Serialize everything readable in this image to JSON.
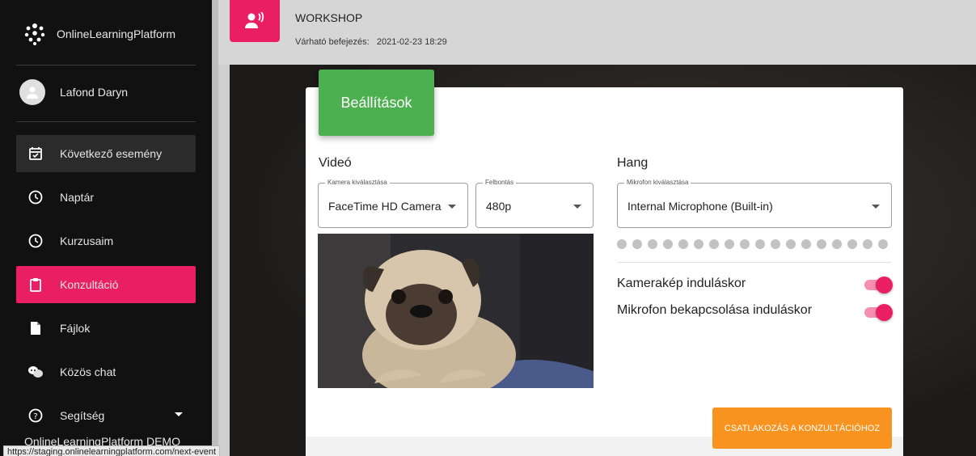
{
  "app": {
    "name": "OnlineLearningPlatform",
    "footer_name": "OnlineLearningPlatform DEMO"
  },
  "status_url": "https://staging.onlinelearningplatform.com/next-event",
  "user": {
    "name": "Lafond Daryn"
  },
  "sidebar": {
    "items": [
      {
        "label": "Következő esemény",
        "icon": "calendar-check-icon",
        "state": "hover"
      },
      {
        "label": "Naptár",
        "icon": "clock-icon"
      },
      {
        "label": "Kurzusaim",
        "icon": "clock-icon"
      },
      {
        "label": "Konzultáció",
        "icon": "clipboard-icon",
        "state": "active"
      },
      {
        "label": "Fájlok",
        "icon": "file-icon"
      },
      {
        "label": "Közös chat",
        "icon": "chat-icon"
      },
      {
        "label": "Segítség",
        "icon": "help-icon"
      }
    ]
  },
  "header": {
    "title": "WORKSHOP",
    "subtitle_label": "Várható befejezés:",
    "subtitle_value": "2021-02-23 18:29",
    "icon": "speaker-voice-icon"
  },
  "settings": {
    "tab_label": "Beállítások",
    "video": {
      "title": "Videó",
      "camera": {
        "legend": "Kamera kiválasztása",
        "value": "FaceTime HD Camera"
      },
      "resolution": {
        "legend": "Felbontás",
        "value": "480p"
      }
    },
    "audio": {
      "title": "Hang",
      "mic": {
        "legend": "Mikrofon kiválasztása",
        "value": "Internal Microphone (Built-in)"
      },
      "level_dots": 18
    },
    "options": [
      {
        "label": "Kamerakép induláskor",
        "on": true
      },
      {
        "label": "Mikrofon bekapcsolása induláskor",
        "on": true
      }
    ],
    "join_button": "CSATLAKOZÁS A KONZULTÁCIÓHOZ"
  },
  "colors": {
    "accent": "#e91e63",
    "green": "#4caf50",
    "orange": "#f7931e",
    "sidebar_bg": "#111111"
  }
}
